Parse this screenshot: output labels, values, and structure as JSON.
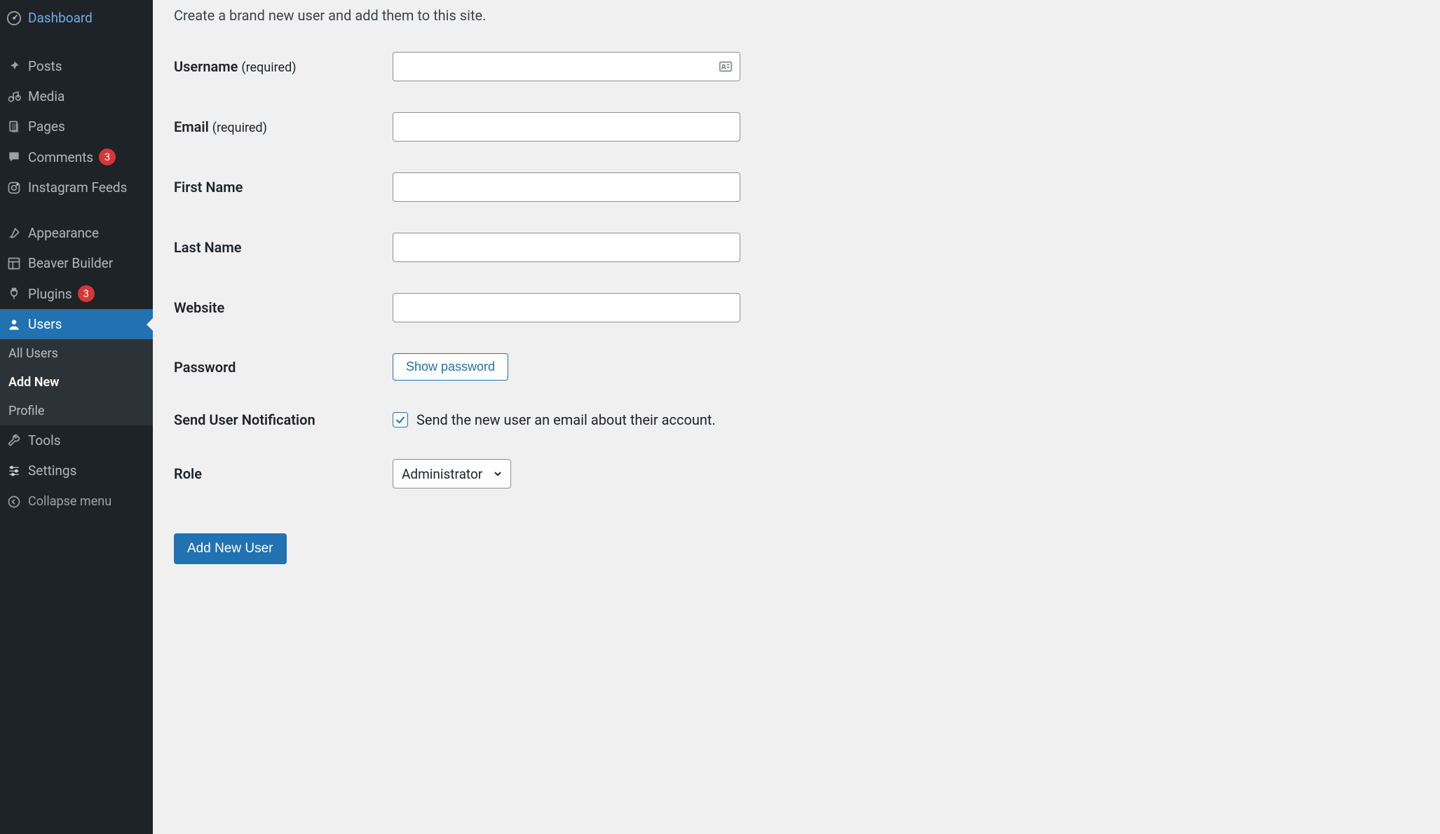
{
  "sidebar": {
    "items": [
      {
        "label": "Dashboard",
        "icon": "dashboard-icon"
      },
      {
        "label": "Posts",
        "icon": "pin-icon"
      },
      {
        "label": "Media",
        "icon": "media-icon"
      },
      {
        "label": "Pages",
        "icon": "pages-icon"
      },
      {
        "label": "Comments",
        "icon": "comment-icon",
        "badge": "3"
      },
      {
        "label": "Instagram Feeds",
        "icon": "instagram-icon"
      },
      {
        "label": "Appearance",
        "icon": "brush-icon"
      },
      {
        "label": "Beaver Builder",
        "icon": "layout-icon"
      },
      {
        "label": "Plugins",
        "icon": "plug-icon",
        "badge": "3"
      },
      {
        "label": "Users",
        "icon": "user-icon",
        "active": true
      },
      {
        "label": "Tools",
        "icon": "wrench-icon"
      },
      {
        "label": "Settings",
        "icon": "sliders-icon"
      }
    ],
    "submenu": {
      "items": [
        {
          "label": "All Users"
        },
        {
          "label": "Add New",
          "current": true
        },
        {
          "label": "Profile"
        }
      ]
    },
    "collapse_label": "Collapse menu"
  },
  "main": {
    "intro": "Create a brand new user and add them to this site.",
    "fields": {
      "username": {
        "label": "Username",
        "required": "(required)"
      },
      "email": {
        "label": "Email",
        "required": "(required)"
      },
      "first_name": {
        "label": "First Name"
      },
      "last_name": {
        "label": "Last Name"
      },
      "website": {
        "label": "Website"
      },
      "password": {
        "label": "Password",
        "button": "Show password"
      },
      "notification": {
        "label": "Send User Notification",
        "checkbox_label": "Send the new user an email about their account.",
        "checked": true
      },
      "role": {
        "label": "Role",
        "selected": "Administrator"
      }
    },
    "submit_label": "Add New User"
  }
}
